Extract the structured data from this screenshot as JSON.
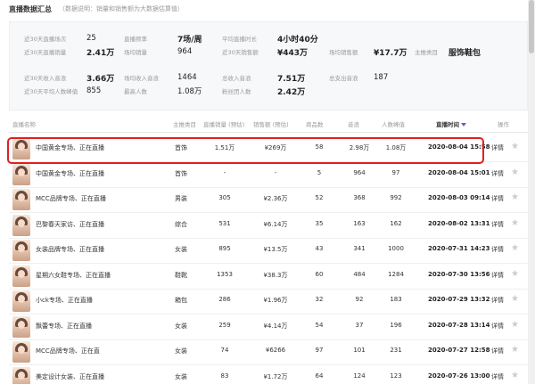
{
  "header": {
    "title": "直播数据汇总",
    "note": "（数据说明：销量和销售额为大数据估算值）"
  },
  "summary": {
    "stats": [
      {
        "label": "近30天直播场次",
        "value": "25"
      },
      {
        "label": "近30天直播销量",
        "value": "2.41万"
      },
      {
        "label": "直播频率",
        "value": "7场/周"
      },
      {
        "label": "场均销量",
        "value": "964"
      },
      {
        "label": "平均直播时长",
        "value": "4小时40分"
      },
      {
        "label": "近30天销售额",
        "value": "¥443万"
      },
      {
        "label": "场均销售额",
        "value": "¥17.7万"
      },
      {
        "label": "主推类目",
        "value": "服饰鞋包"
      },
      {
        "label": "近30天收入音浪",
        "value": "3.66万"
      },
      {
        "label": "近30天平均人数峰值",
        "value": "855"
      },
      {
        "label": "场均收入音浪",
        "value": "1464"
      },
      {
        "label": "最高人数",
        "value": "1.08万"
      },
      {
        "label": "总收入音浪",
        "value": "7.51万"
      },
      {
        "label": "粉丝团人数",
        "value": "2.42万"
      },
      {
        "label": "总支出音浪",
        "value": "187"
      }
    ]
  },
  "table": {
    "columns": {
      "name": "直播名称",
      "category": "主推类目",
      "sales": "直播销量 (预估)",
      "revenue": "销售额 (预估)",
      "products": "商品数",
      "yinlang": "音浪",
      "peak": "人数峰值",
      "time": "直播时间",
      "action": "操作"
    },
    "rows": [
      {
        "name": "中国黄金专场、正在直播",
        "category": "首饰",
        "sales": "1.51万",
        "revenue": "¥269万",
        "products": "58",
        "yinlang": "2.98万",
        "peak": "1.08万",
        "time": "2020-08-04 15:58",
        "detail": "详情"
      },
      {
        "name": "中国黄金专场、正在直播",
        "category": "首饰",
        "sales": "-",
        "revenue": "-",
        "products": "5",
        "yinlang": "964",
        "peak": "97",
        "time": "2020-08-04 15:01",
        "detail": "详情"
      },
      {
        "name": "MCC品牌专场、正在直播",
        "category": "男装",
        "sales": "305",
        "revenue": "¥2.36万",
        "products": "52",
        "yinlang": "368",
        "peak": "992",
        "time": "2020-08-03 09:14",
        "detail": "详情"
      },
      {
        "name": "巴黎春天家访、正在直播",
        "category": "综合",
        "sales": "531",
        "revenue": "¥6.14万",
        "products": "35",
        "yinlang": "163",
        "peak": "162",
        "time": "2020-08-02 13:31",
        "detail": "详情"
      },
      {
        "name": "女装品牌专场、正在直播",
        "category": "女装",
        "sales": "895",
        "revenue": "¥13.5万",
        "products": "43",
        "yinlang": "341",
        "peak": "1000",
        "time": "2020-07-31 14:23",
        "detail": "详情"
      },
      {
        "name": "星期六女鞋专场、正在直播",
        "category": "鞋靴",
        "sales": "1353",
        "revenue": "¥38.3万",
        "products": "60",
        "yinlang": "484",
        "peak": "1284",
        "time": "2020-07-30 13:56",
        "detail": "详情"
      },
      {
        "name": "小ck专场、正在直播",
        "category": "箱包",
        "sales": "286",
        "revenue": "¥1.96万",
        "products": "32",
        "yinlang": "92",
        "peak": "183",
        "time": "2020-07-29 13:32",
        "detail": "详情"
      },
      {
        "name": "飘蕾专场、正在直播",
        "category": "女装",
        "sales": "259",
        "revenue": "¥4.14万",
        "products": "54",
        "yinlang": "37",
        "peak": "196",
        "time": "2020-07-28 13:14",
        "detail": "详情"
      },
      {
        "name": "MCC品牌专场、正在直",
        "category": "女装",
        "sales": "74",
        "revenue": "¥6266",
        "products": "97",
        "yinlang": "101",
        "peak": "231",
        "time": "2020-07-27 12:58",
        "detail": "详情"
      },
      {
        "name": "美定设计女装、正在直播",
        "category": "女装",
        "sales": "83",
        "revenue": "¥1.72万",
        "products": "64",
        "yinlang": "124",
        "peak": "123",
        "time": "2020-07-26 13:00",
        "detail": "详情"
      }
    ]
  },
  "colors": {
    "highlight": "#e02020",
    "sort_caret": "#6a5acd"
  },
  "icons": {
    "favorite": "star-icon",
    "sort": "caret-down-icon"
  }
}
